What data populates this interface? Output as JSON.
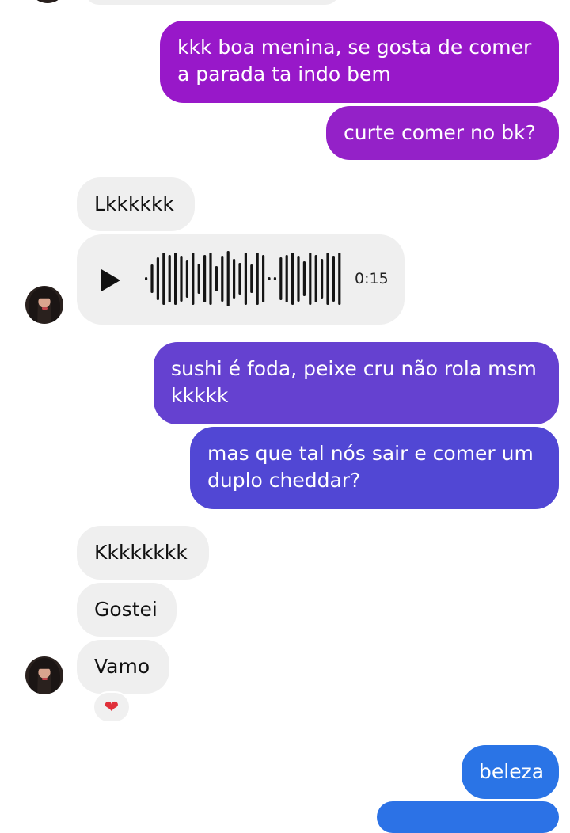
{
  "messages": {
    "m1": "kkk boa menina, se gosta de comer",
    "m1b": "a parada ta indo bem",
    "m2": "curte comer no bk?",
    "m3": "Lkkkkkk",
    "voice_duration": "0:15",
    "m4": "sushi é foda, peixe cru não rola msm",
    "m4b": "kkkkk",
    "m5": "mas que tal nós sair e comer um",
    "m5b": "duplo cheddar?",
    "m6": "Kkkkkkkk",
    "m7": "Gostei",
    "m8": "Vamo",
    "reaction": "❤",
    "m9": "beleza"
  },
  "icons": {
    "play": "play-icon",
    "reaction": "heart-icon",
    "avatar": "contact-avatar"
  },
  "colors": {
    "outgoing_top": "#9d19c8",
    "outgoing_mid": "#5d44d2",
    "outgoing_bottom": "#2c72e6",
    "incoming": "#efefef"
  }
}
